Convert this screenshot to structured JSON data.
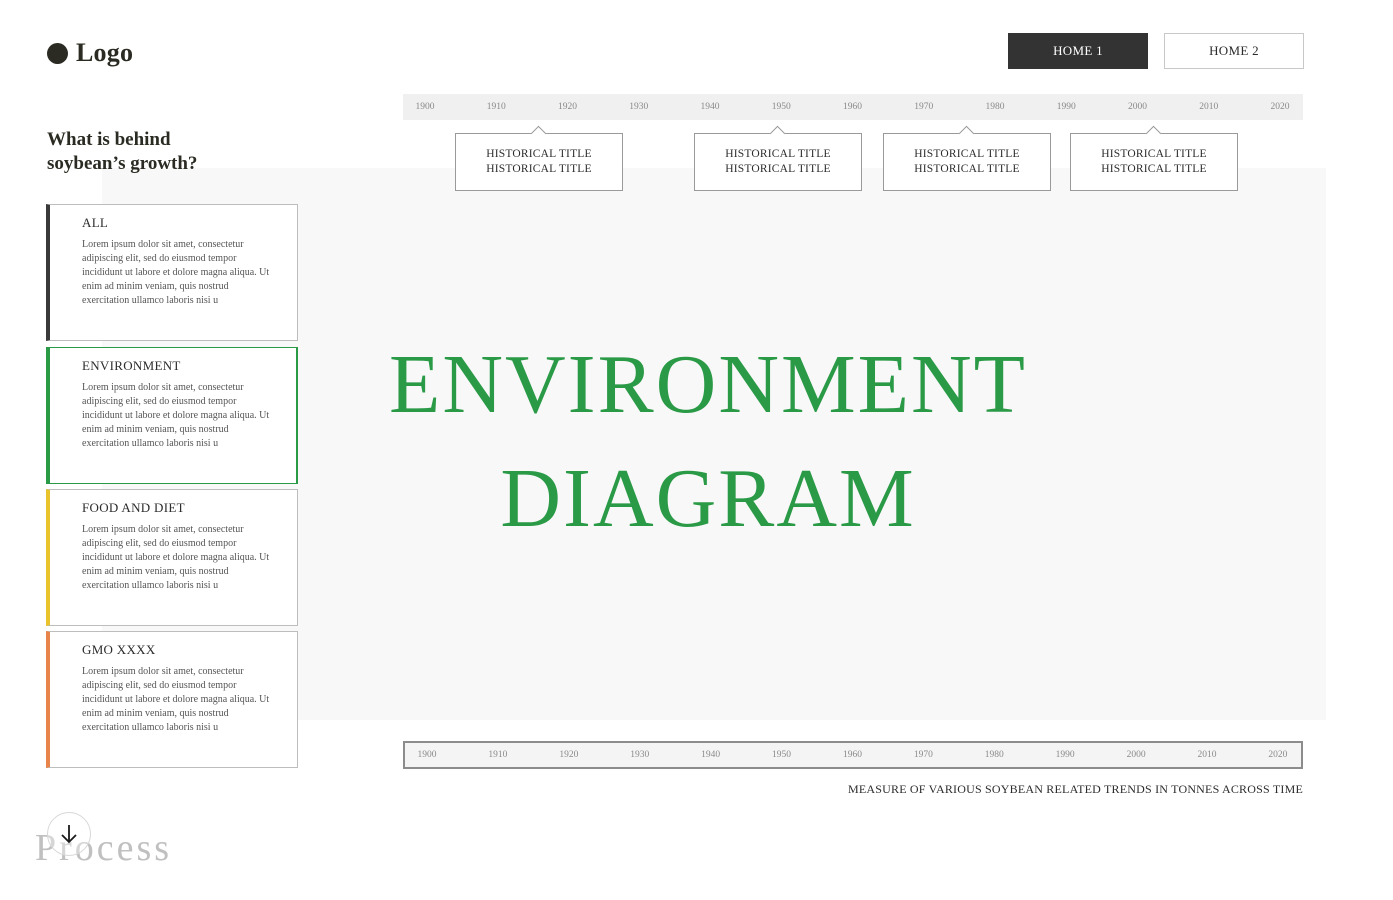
{
  "header": {
    "logo_text": "Logo",
    "nav": [
      {
        "label": "HOME 1",
        "active": true
      },
      {
        "label": "HOME 2",
        "active": false
      }
    ]
  },
  "sidebar": {
    "question": "What is behind soybean’s growth?",
    "categories": [
      {
        "title": "ALL",
        "description": "Lorem ipsum dolor sit amet, consectetur adipiscing elit, sed do eiusmod tempor incididunt ut labore et dolore magna aliqua. Ut enim ad minim veniam, quis nostrud exercitation ullamco laboris nisi u",
        "color": "#3a3a3a"
      },
      {
        "title": "ENVIRONMENT",
        "description": "Lorem ipsum dolor sit amet, consectetur adipiscing elit, sed do eiusmod tempor incididunt ut labore et dolore magna aliqua. Ut enim ad minim veniam, quis nostrud exercitation ullamco laboris nisi u",
        "color": "#2a9a47"
      },
      {
        "title": "FOOD AND DIET",
        "description": "Lorem ipsum dolor sit amet, consectetur adipiscing elit, sed do eiusmod tempor incididunt ut labore et dolore magna aliqua. Ut enim ad minim veniam, quis nostrud exercitation ullamco laboris nisi u",
        "color": "#e8c32c"
      },
      {
        "title": "GMO XXXX",
        "description": "Lorem ipsum dolor sit amet, consectetur adipiscing elit, sed do eiusmod tempor incididunt ut labore et dolore magna aliqua. Ut enim ad minim veniam, quis nostrud exercitation ullamco laboris nisi u",
        "color": "#e8844a"
      }
    ]
  },
  "timeline": {
    "years": [
      "1900",
      "1910",
      "1920",
      "1930",
      "1940",
      "1950",
      "1960",
      "1970",
      "1980",
      "1990",
      "2000",
      "2010",
      "2020"
    ],
    "events": [
      {
        "line1": "HISTORICAL TITLE",
        "line2": "HISTORICAL TITLE",
        "year": "1920"
      },
      {
        "line1": "HISTORICAL TITLE",
        "line2": "HISTORICAL TITLE",
        "year": "1950"
      },
      {
        "line1": "HISTORICAL TITLE",
        "line2": "HISTORICAL TITLE",
        "year": "1970"
      },
      {
        "line1": "HISTORICAL TITLE",
        "line2": "HISTORICAL TITLE",
        "year": "2000"
      }
    ]
  },
  "diagram": {
    "title_line1": "ENVIRONMENT",
    "title_line2": "DIAGRAM",
    "color": "#2a9a47"
  },
  "caption": "MEASURE OF VARIOUS SOYBEAN RELATED TRENDS IN TONNES ACROSS TIME",
  "footer": {
    "process_label": "Process",
    "scroll_icon": "arrow-down-icon"
  }
}
